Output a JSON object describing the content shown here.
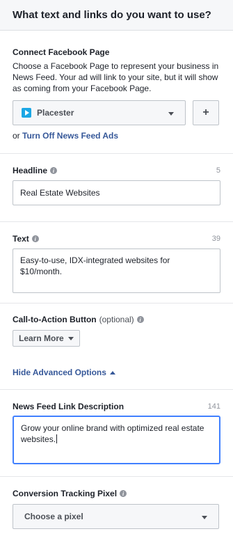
{
  "header": {
    "title": "What text and links do you want to use?"
  },
  "connect_page": {
    "label": "Connect Facebook Page",
    "description": "Choose a Facebook Page to represent your business in News Feed. Your ad will link to your site, but it will show as coming from your Facebook Page.",
    "selected_page": "Placester",
    "add_button": "+",
    "or_text": "or",
    "turn_off_link": "Turn Off News Feed Ads"
  },
  "headline": {
    "label": "Headline",
    "count": "5",
    "value": "Real Estate Websites"
  },
  "text": {
    "label": "Text",
    "count": "39",
    "value": "Easy-to-use, IDX-integrated websites for $10/month."
  },
  "cta": {
    "label": "Call-to-Action Button",
    "optional": "(optional)",
    "selected": "Learn More"
  },
  "advanced": {
    "toggle_label": "Hide Advanced Options"
  },
  "news_feed_link": {
    "label": "News Feed Link Description",
    "count": "141",
    "value": "Grow your online brand with optimized real estate websites."
  },
  "conversion_pixel": {
    "label": "Conversion Tracking Pixel",
    "placeholder": "Choose a pixel"
  },
  "colors": {
    "link": "#365899",
    "focus_border": "#4080ff",
    "page_icon": "#1ba7e5"
  }
}
